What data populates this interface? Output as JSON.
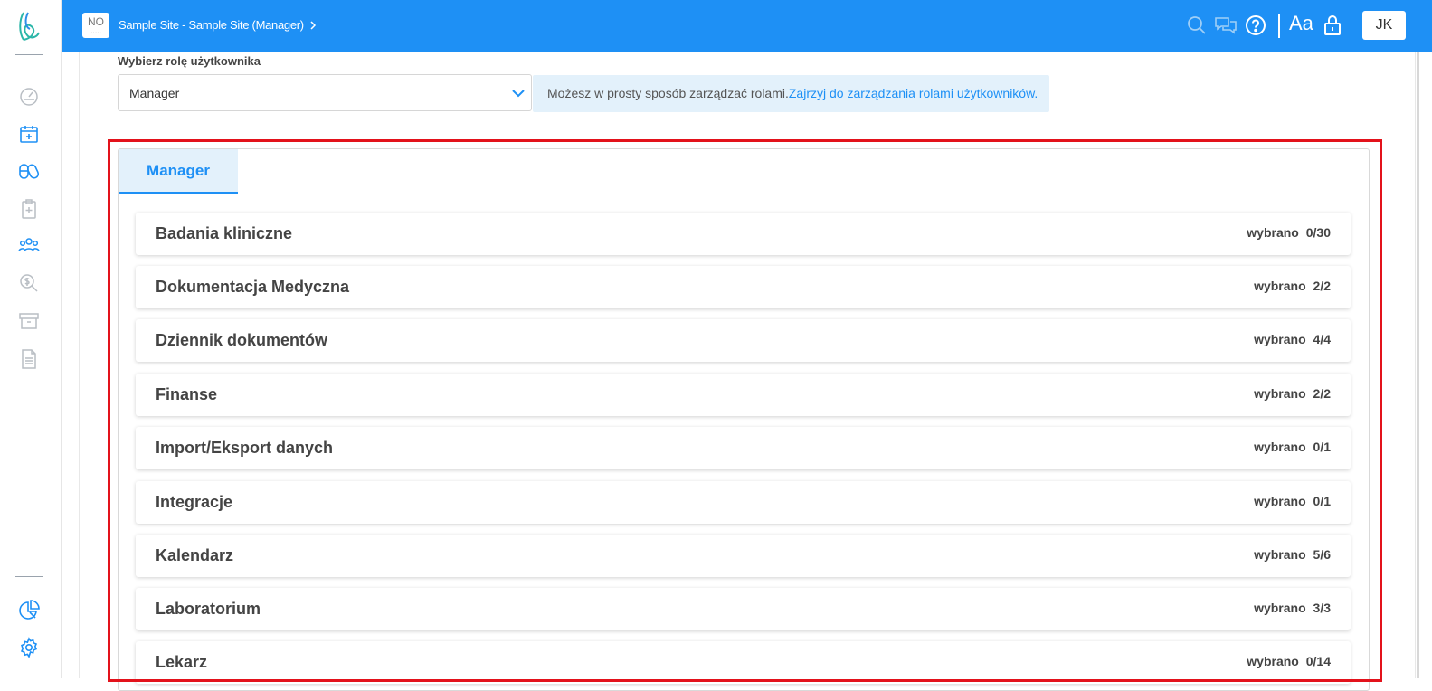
{
  "header": {
    "site_logo_text": "NO",
    "site_name": "Sample Site - Sample Site (Manager)",
    "font_toggle_label": "Aa",
    "user_initials": "JK"
  },
  "role_selector": {
    "label": "Wybierz rolę użytkownika",
    "selected": "Manager"
  },
  "info": {
    "text": "Możesz w prosty sposób zarządzać rolami.",
    "link": "Zajrzyj do zarządzania rolami użytkowników."
  },
  "tabs": [
    {
      "label": "Manager",
      "active": true
    }
  ],
  "permissions": [
    {
      "name": "Badania kliniczne",
      "selected_label": "wybrano 0/30"
    },
    {
      "name": "Dokumentacja Medyczna",
      "selected_label": "wybrano 2/2"
    },
    {
      "name": "Dziennik dokumentów",
      "selected_label": "wybrano 4/4"
    },
    {
      "name": "Finanse",
      "selected_label": "wybrano 2/2"
    },
    {
      "name": "Import/Eksport danych",
      "selected_label": "wybrano 0/1"
    },
    {
      "name": "Integracje",
      "selected_label": "wybrano 0/1"
    },
    {
      "name": "Kalendarz",
      "selected_label": "wybrano 5/6"
    },
    {
      "name": "Laboratorium",
      "selected_label": "wybrano 3/3"
    },
    {
      "name": "Lekarz",
      "selected_label": "wybrano 0/14"
    }
  ],
  "sidebar": {
    "icons": [
      "dashboard-gauge-icon",
      "calendar-add-icon",
      "pills-icon",
      "clipboard-plus-icon",
      "users-icon",
      "search-money-icon",
      "archive-box-icon",
      "document-icon",
      "pie-chart-icon",
      "settings-gear-icon"
    ]
  },
  "colors": {
    "brand": "#1e90f5",
    "highlight_border": "#e3121b",
    "info_bg": "#e3f1fb"
  }
}
